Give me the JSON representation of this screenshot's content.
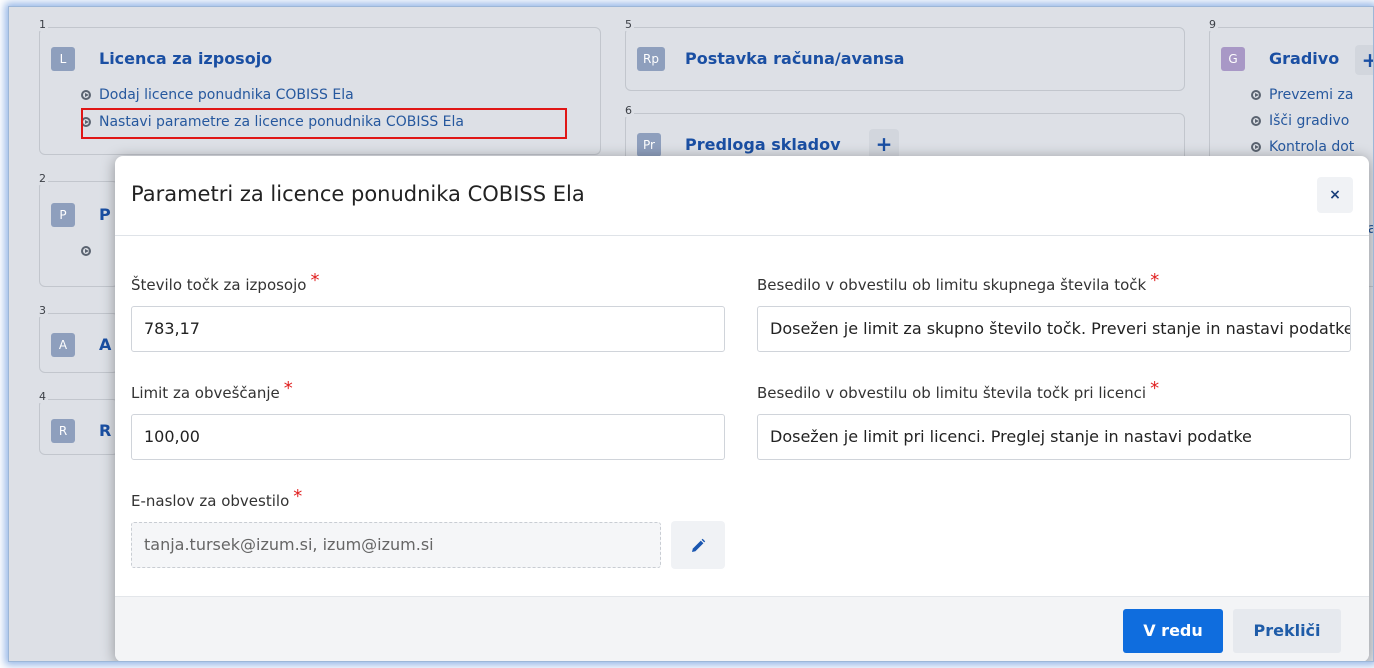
{
  "panels": {
    "p1": {
      "number": "1",
      "badge": "L",
      "title": "Licenca za izposojo",
      "links": [
        "Dodaj licence ponudnika COBISS Ela",
        "Nastavi parametre za licence ponudnika COBISS Ela"
      ]
    },
    "p2": {
      "number": "2",
      "badge": "P",
      "title": "P"
    },
    "p3": {
      "number": "3",
      "badge": "A",
      "title": "A"
    },
    "p4": {
      "number": "4",
      "badge": "R",
      "title": "R"
    },
    "p5": {
      "number": "5",
      "badge": "Rp",
      "title": "Postavka računa/avansa"
    },
    "p6": {
      "number": "6",
      "badge": "Pr",
      "title": "Predloga skladov",
      "plus": "+"
    },
    "p9": {
      "number": "9",
      "badge": "G",
      "title": "Gradivo",
      "plus": "+",
      "links": [
        "Prevzemi za",
        "Išči gradivo",
        "Kontrola dot"
      ],
      "partial": "da"
    }
  },
  "modal": {
    "title": "Parametri za licence ponudnika COBISS Ela",
    "close_icon": "×",
    "fields": {
      "points": {
        "label": "Število točk za izposojo",
        "value": "783,17"
      },
      "limit": {
        "label": "Limit za obveščanje",
        "value": "100,00"
      },
      "email": {
        "label": "E-naslov za obvestilo",
        "value": "tanja.tursek@izum.si, izum@izum.si"
      },
      "total_text": {
        "label": "Besedilo v obvestilu ob limitu skupnega števila točk",
        "value": "Dosežen je limit za skupno število točk. Preveri stanje in nastavi podatke"
      },
      "license_text": {
        "label": "Besedilo v obvestilu ob limitu števila točk pri licenci",
        "value": "Dosežen je limit pri licenci. Preglej stanje in nastavi podatke"
      }
    },
    "required_mark": "*",
    "buttons": {
      "ok": "V redu",
      "cancel": "Prekliči"
    }
  },
  "colors": {
    "primary": "#0f6dde",
    "link": "#26589e",
    "required": "#e02020",
    "highlight": "#e01616"
  }
}
